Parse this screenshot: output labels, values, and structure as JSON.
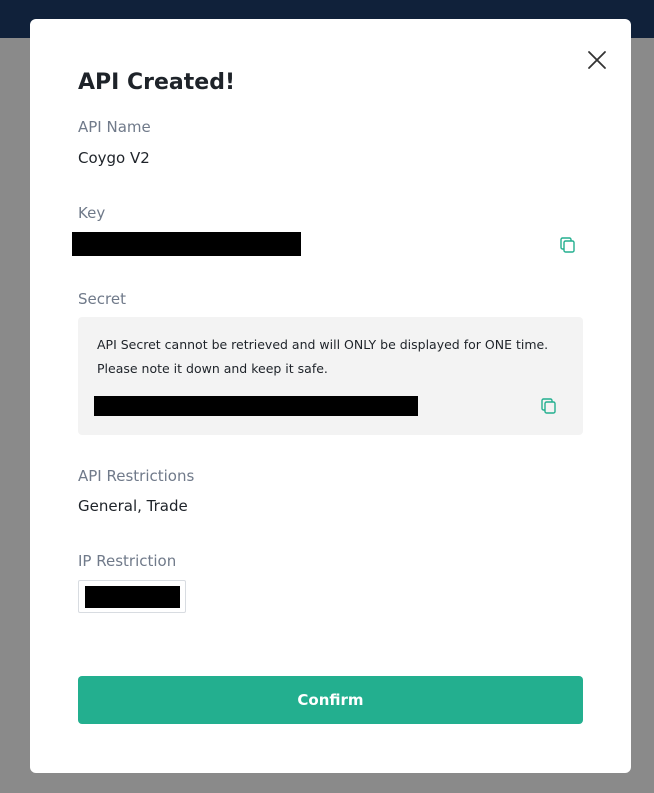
{
  "modal": {
    "title": "API Created!",
    "api_name": {
      "label": "API Name",
      "value": "Coygo V2"
    },
    "key": {
      "label": "Key",
      "copy_icon": "copy-icon"
    },
    "secret": {
      "label": "Secret",
      "note_line1": "API Secret cannot be retrieved and will ONLY be displayed for ONE time.",
      "note_line2": "Please note it down and keep it safe.",
      "copy_icon": "copy-icon"
    },
    "restrictions": {
      "label": "API Restrictions",
      "value": "General, Trade"
    },
    "ip_restriction": {
      "label": "IP Restriction"
    },
    "confirm_label": "Confirm",
    "close_icon": "close-icon"
  },
  "colors": {
    "accent": "#23af8f",
    "topbar": "#10213a",
    "overlay": "#8a8a8a"
  }
}
